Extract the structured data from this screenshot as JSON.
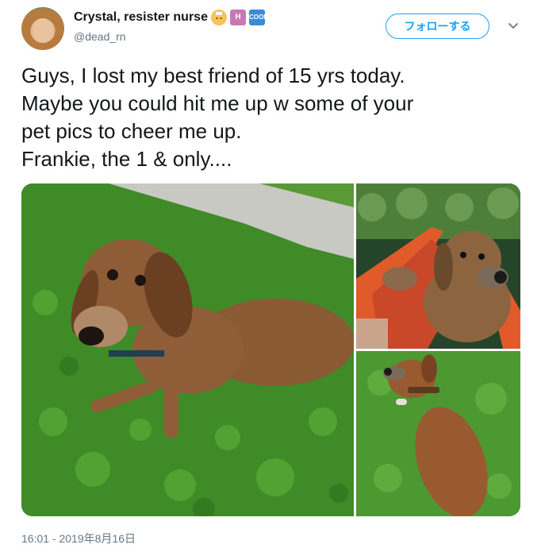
{
  "user": {
    "display_name": "Crystal, resister nurse",
    "handle": "@dead_rn",
    "badges": [
      "nurse-emoji",
      "hospital-emoji",
      "cool-emoji"
    ],
    "cool_badge_text": "COOL",
    "hospital_badge_text": "H"
  },
  "actions": {
    "follow_label": "フォローする"
  },
  "tweet": {
    "lines": [
      "Guys, I lost my best friend of 15 yrs today.",
      "Maybe you could hit me up w some of your",
      "pet pics to cheer me up.",
      "Frankie, the 1 & only...."
    ],
    "timestamp": "16:01 - 2019年8月16日"
  },
  "colors": {
    "accent": "#1da1f2",
    "secondary_text": "#657786",
    "text": "#14171a"
  }
}
